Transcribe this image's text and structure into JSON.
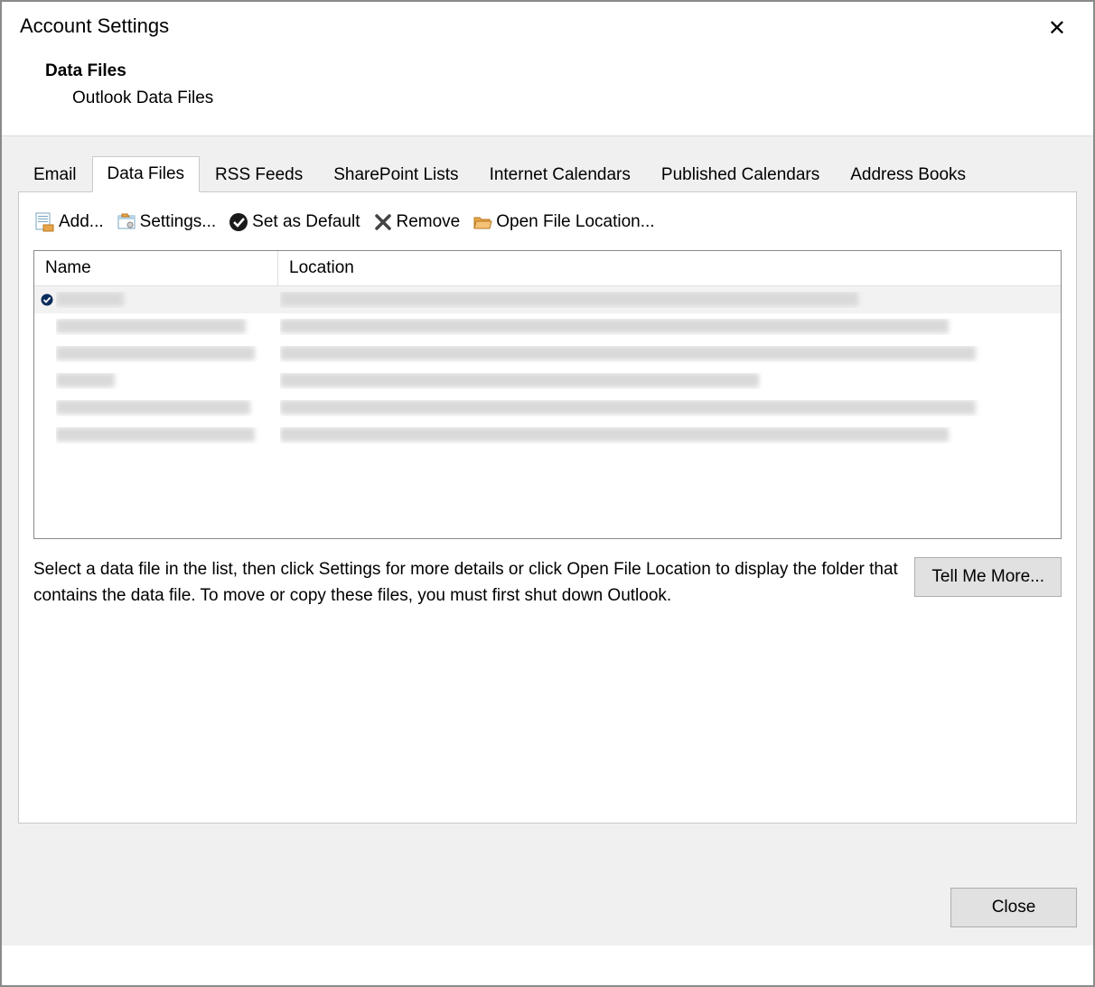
{
  "dialog": {
    "title": "Account Settings",
    "section_title": "Data Files",
    "section_subtitle": "Outlook Data Files"
  },
  "tabs": [
    {
      "label": "Email",
      "active": false
    },
    {
      "label": "Data Files",
      "active": true
    },
    {
      "label": "RSS Feeds",
      "active": false
    },
    {
      "label": "SharePoint Lists",
      "active": false
    },
    {
      "label": "Internet Calendars",
      "active": false
    },
    {
      "label": "Published Calendars",
      "active": false
    },
    {
      "label": "Address Books",
      "active": false
    }
  ],
  "toolbar": {
    "add": "Add...",
    "settings": "Settings...",
    "set_default": "Set as Default",
    "remove": "Remove",
    "open_location": "Open File Location..."
  },
  "columns": {
    "name": "Name",
    "location": "Location"
  },
  "rows": [
    {
      "default": true,
      "name_obscured": true,
      "location_obscured": true,
      "name_width": 75,
      "loc_width": 640
    },
    {
      "default": false,
      "name_obscured": true,
      "location_obscured": true,
      "name_width": 210,
      "loc_width": 740
    },
    {
      "default": false,
      "name_obscured": true,
      "location_obscured": true,
      "name_width": 220,
      "loc_width": 770
    },
    {
      "default": false,
      "name_obscured": true,
      "location_obscured": true,
      "name_width": 65,
      "loc_width": 530
    },
    {
      "default": false,
      "name_obscured": true,
      "location_obscured": true,
      "name_width": 215,
      "loc_width": 770
    },
    {
      "default": false,
      "name_obscured": true,
      "location_obscured": true,
      "name_width": 220,
      "loc_width": 740
    }
  ],
  "info_text": "Select a data file in the list, then click Settings for more details or click Open File Location to display the folder that contains the data file. To move or copy these files, you must first shut down Outlook.",
  "buttons": {
    "tell_me_more": "Tell Me More...",
    "close": "Close"
  }
}
